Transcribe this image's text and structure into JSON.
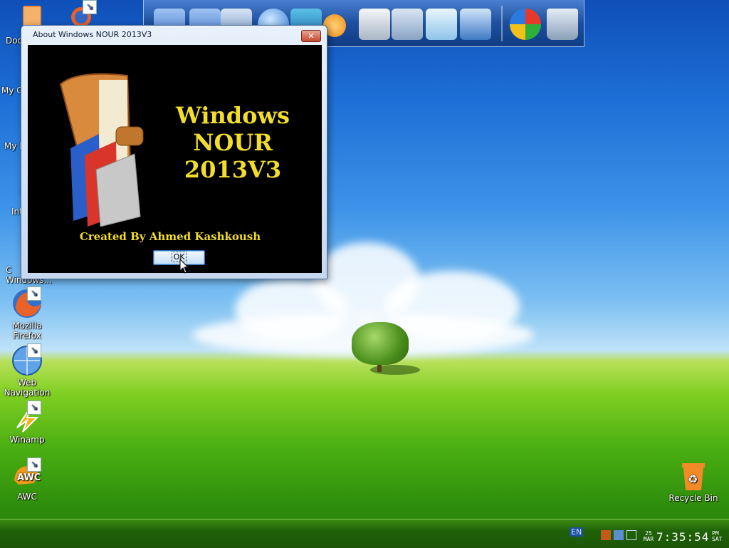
{
  "desktop": {
    "icons": [
      {
        "label": "Doc"
      },
      {
        "label": "My C"
      },
      {
        "label": "My N P"
      },
      {
        "label": "Int Ex"
      },
      {
        "label": "C Windows..."
      },
      {
        "label": "Mozilla Firefox"
      },
      {
        "label": "Web Navigation"
      },
      {
        "label": "Winamp"
      },
      {
        "label": "AWC"
      }
    ],
    "recycle_bin": {
      "label": "Recycle Bin"
    }
  },
  "dock": {
    "items": [
      "folder-icon",
      "folder-icon",
      "explorer-icon",
      "globe-icon",
      "media-icon",
      "media-player-icon",
      "calculator-icon",
      "paint-icon",
      "notepad-icon",
      "system-icon",
      "start-orb-icon",
      "trash-icon"
    ]
  },
  "dialog": {
    "title": "About Windows NOUR 2013V3",
    "close_glyph": "✕",
    "product_line1": "Windows",
    "product_line2": "NOUR",
    "product_line3": "2013V3",
    "credit": "Created By Ahmed Kashkoush",
    "ok_label": "OK"
  },
  "taskbar": {
    "language": "EN",
    "date_day": "25",
    "date_month": "MAR",
    "time": "7:35:54",
    "ampm": "PM",
    "weekday": "SAT"
  }
}
